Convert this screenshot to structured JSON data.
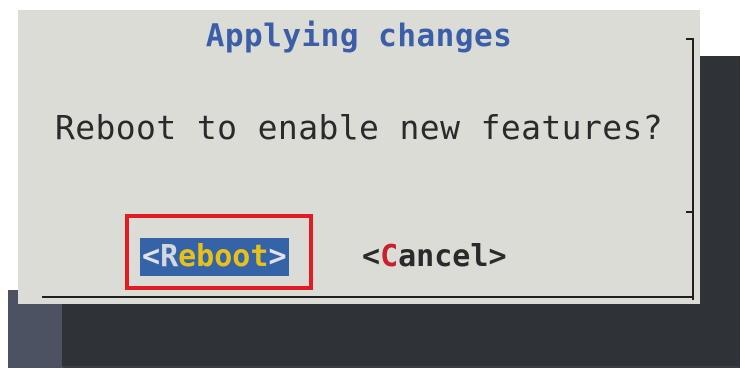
{
  "dialog": {
    "title": "Applying changes",
    "message": "Reboot to enable new features?",
    "buttons": {
      "reboot": {
        "open": "<",
        "hotkey": "R",
        "rest": "eboot",
        "close": ">",
        "selected": true
      },
      "cancel": {
        "open": "<",
        "hotkey": "C",
        "rest": "ancel",
        "close": ">",
        "selected": false
      }
    }
  },
  "colors": {
    "dialog_bg": "#dcdcd6",
    "title": "#3a5ea8",
    "selected_button_bg": "#3463a8",
    "selected_button_text": "#e8c018",
    "cancel_hotkey": "#c8202c",
    "highlight_box": "#e31b23"
  }
}
